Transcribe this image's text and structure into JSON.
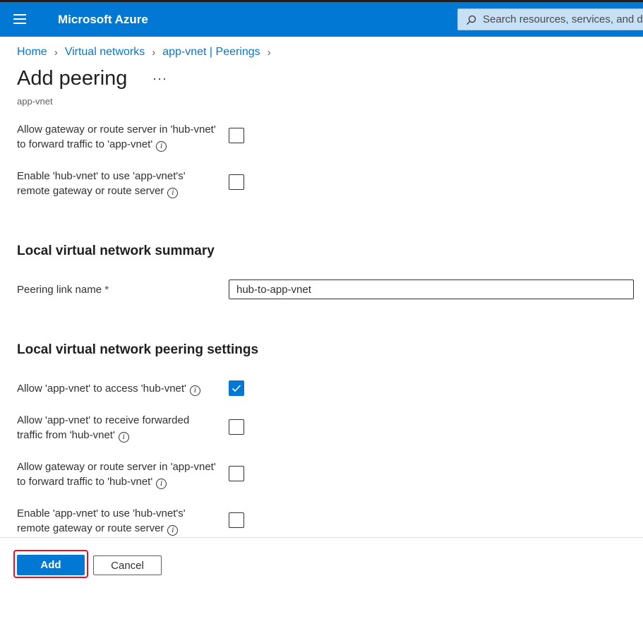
{
  "header": {
    "brand": "Microsoft Azure",
    "search_placeholder": "Search resources, services, and docs",
    "accent_color": "#0078d4"
  },
  "breadcrumb": {
    "items": [
      "Home",
      "Virtual networks",
      "app-vnet | Peerings"
    ]
  },
  "page": {
    "title": "Add peering",
    "more_label": "···",
    "subtitle": "app-vnet"
  },
  "remote_settings": [
    {
      "line1": "Allow gateway or route server in 'hub-vnet'",
      "line2": "to forward traffic to 'app-vnet'",
      "checked": false
    },
    {
      "line1": "Enable 'hub-vnet' to use 'app-vnet's'",
      "line2": "remote gateway or route server",
      "checked": false
    }
  ],
  "summary": {
    "heading": "Local virtual network summary",
    "link_name_label": "Peering link name",
    "required_mark": "*",
    "link_name_value": "hub-to-app-vnet"
  },
  "local_settings": {
    "heading": "Local virtual network peering settings",
    "items": [
      {
        "line1": "Allow 'app-vnet' to access 'hub-vnet'",
        "line2": "",
        "checked": true
      },
      {
        "line1": "Allow 'app-vnet' to receive forwarded",
        "line2": "traffic from 'hub-vnet'",
        "checked": false
      },
      {
        "line1": "Allow gateway or route server in 'app-vnet'",
        "line2": "to forward traffic to 'hub-vnet'",
        "checked": false
      },
      {
        "line1": "Enable 'app-vnet' to use 'hub-vnet's'",
        "line2": "remote gateway or route server",
        "checked": false
      }
    ]
  },
  "footer": {
    "add_label": "Add",
    "cancel_label": "Cancel"
  },
  "icons": {
    "menu": "hamburger-menu-icon",
    "search": "search-icon",
    "info": "info-icon",
    "check": "checkmark-icon"
  }
}
